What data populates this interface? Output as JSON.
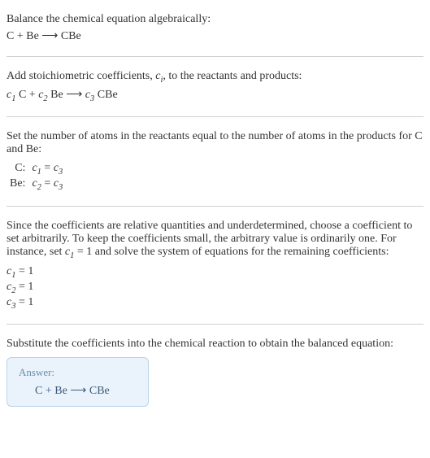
{
  "sections": {
    "intro": {
      "heading": "Balance the chemical equation algebraically:",
      "equation": "C + Be  ⟶  CBe"
    },
    "stoich": {
      "text_before": "Add stoichiometric coefficients, ",
      "ci": "c",
      "ci_sub": "i",
      "text_after": ", to the reactants and products:",
      "eq_c1": "c",
      "eq_c1_sub": "1",
      "eq_t1": " C + ",
      "eq_c2": "c",
      "eq_c2_sub": "2",
      "eq_t2": " Be  ⟶  ",
      "eq_c3": "c",
      "eq_c3_sub": "3",
      "eq_t3": " CBe"
    },
    "atoms": {
      "text": "Set the number of atoms in the reactants equal to the number of atoms in the products for C and Be:",
      "rows": [
        {
          "label": "C:",
          "c_l": "c",
          "sub_l": "1",
          "mid": " = ",
          "c_r": "c",
          "sub_r": "3"
        },
        {
          "label": "Be:",
          "c_l": "c",
          "sub_l": "2",
          "mid": " = ",
          "c_r": "c",
          "sub_r": "3"
        }
      ]
    },
    "solve": {
      "text_before": "Since the coefficients are relative quantities and underdetermined, choose a coefficient to set arbitrarily. To keep the coefficients small, the arbitrary value is ordinarily one. For instance, set ",
      "c1": "c",
      "c1_sub": "1",
      "text_after": " = 1 and solve the system of equations for the remaining coefficients:",
      "coeffs": [
        {
          "c": "c",
          "sub": "1",
          "val": " = 1"
        },
        {
          "c": "c",
          "sub": "2",
          "val": " = 1"
        },
        {
          "c": "c",
          "sub": "3",
          "val": " = 1"
        }
      ]
    },
    "final": {
      "text": "Substitute the coefficients into the chemical reaction to obtain the balanced equation:"
    },
    "answer": {
      "label": "Answer:",
      "equation": "C + Be  ⟶  CBe"
    }
  }
}
